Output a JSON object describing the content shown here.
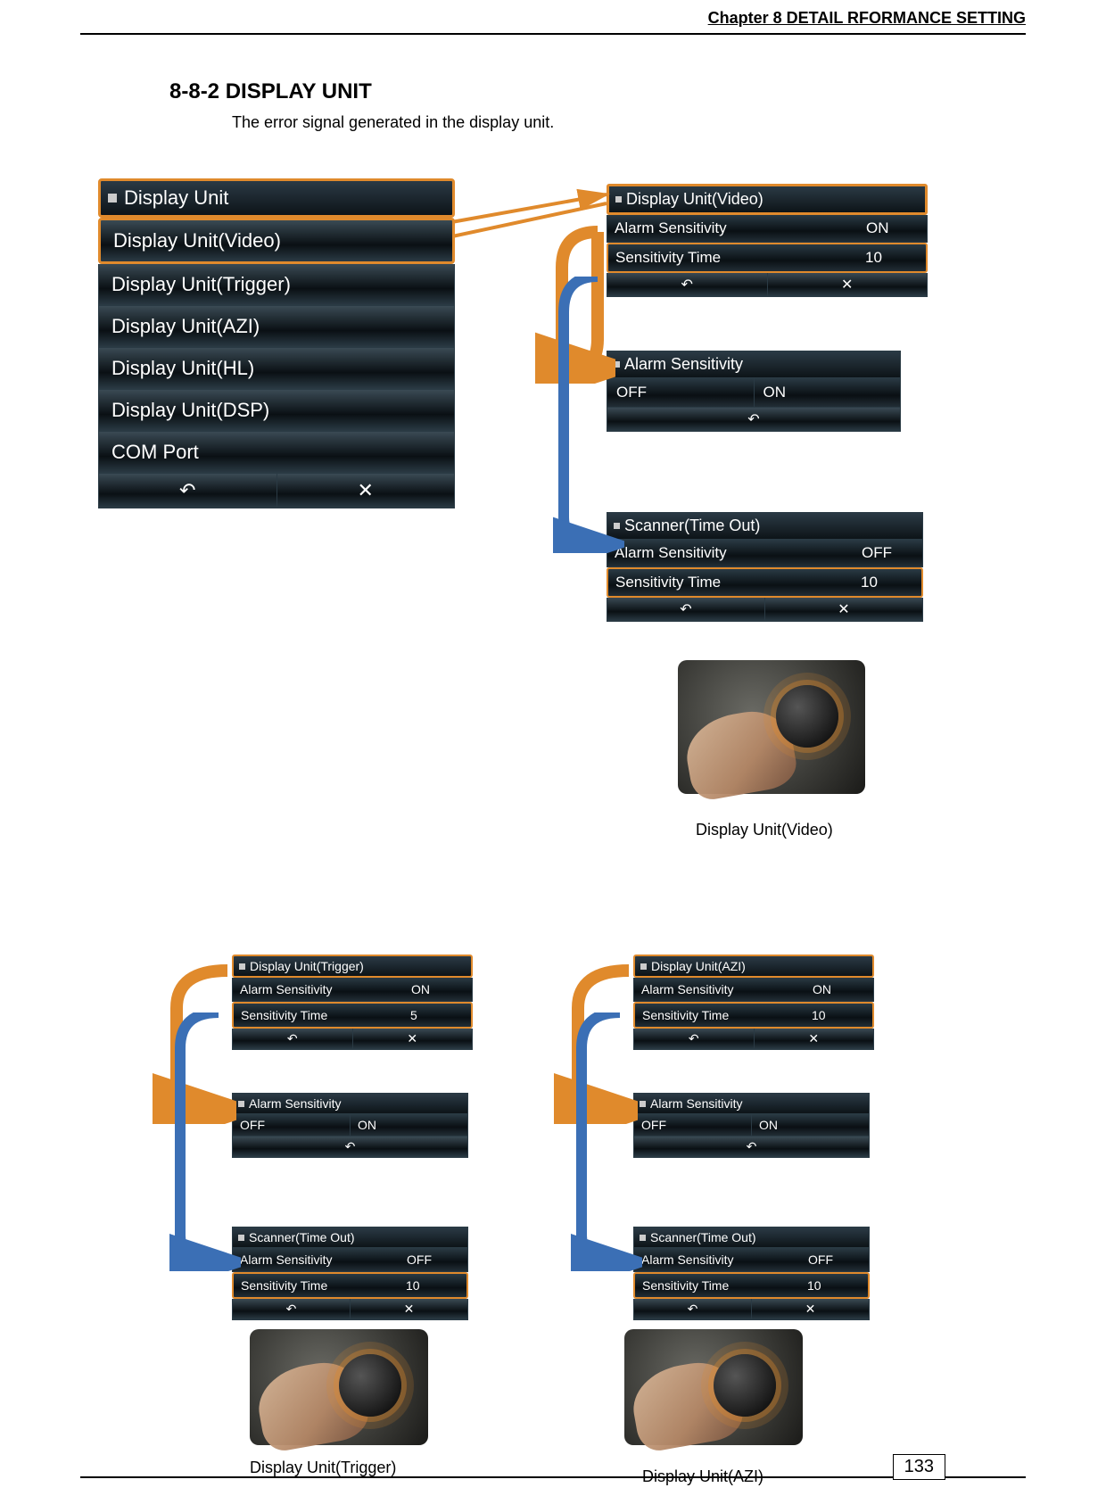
{
  "chapter": "Chapter 8  DETAIL RFORMANCE SETTING",
  "section_title": "8-8-2 DISPLAY UNIT",
  "section_desc": "The error signal generated in the display unit.",
  "main_menu": {
    "title": "Display Unit",
    "items": [
      "Display Unit(Video)",
      "Display Unit(Trigger)",
      "Display Unit(AZI)",
      "Display Unit(HL)",
      "Display Unit(DSP)",
      "COM Port"
    ]
  },
  "back_icon": "↶",
  "close_icon": "✕",
  "video_panel": {
    "title": "Display Unit(Video)",
    "rows": [
      {
        "label": "Alarm Sensitivity",
        "value": "ON"
      },
      {
        "label": "Sensitivity Time",
        "value": "10"
      }
    ]
  },
  "alarm_panel": {
    "title": "Alarm Sensitivity",
    "off": "OFF",
    "on": "ON"
  },
  "scanner_panel": {
    "title": "Scanner(Time Out)",
    "rows": [
      {
        "label": "Alarm Sensitivity",
        "value": "OFF"
      },
      {
        "label": "Sensitivity Time",
        "value": "10"
      }
    ]
  },
  "trigger_panel": {
    "title": "Display Unit(Trigger)",
    "rows": [
      {
        "label": "Alarm Sensitivity",
        "value": "ON"
      },
      {
        "label": "Sensitivity Time",
        "value": "5"
      }
    ]
  },
  "trigger_alarm": {
    "title": "Alarm Sensitivity",
    "off": "OFF",
    "on": "ON"
  },
  "trigger_scanner": {
    "title": "Scanner(Time Out)",
    "rows": [
      {
        "label": "Alarm Sensitivity",
        "value": "OFF"
      },
      {
        "label": "Sensitivity Time",
        "value": "10"
      }
    ]
  },
  "azi_panel": {
    "title": "Display Unit(AZI)",
    "rows": [
      {
        "label": "Alarm Sensitivity",
        "value": "ON"
      },
      {
        "label": "Sensitivity Time",
        "value": "10"
      }
    ]
  },
  "azi_alarm": {
    "title": "Alarm Sensitivity",
    "off": "OFF",
    "on": "ON"
  },
  "azi_scanner": {
    "title": "Scanner(Time Out)",
    "rows": [
      {
        "label": "Alarm Sensitivity",
        "value": "OFF"
      },
      {
        "label": "Sensitivity Time",
        "value": "10"
      }
    ]
  },
  "captions": {
    "video": "Display Unit(Video)",
    "trigger": "Display Unit(Trigger)",
    "azi": "Display Unit(AZI)"
  },
  "page_number": "133"
}
